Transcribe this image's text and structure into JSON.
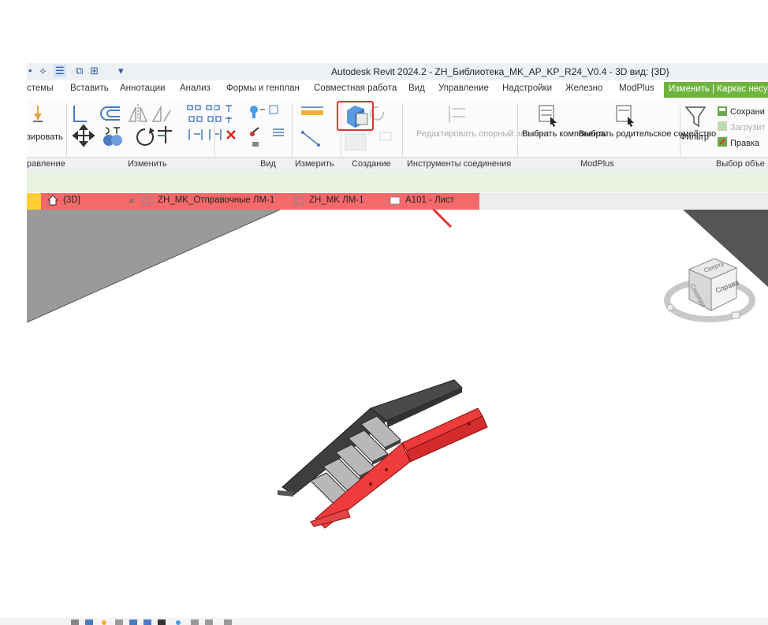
{
  "window": {
    "title": "Autodesk Revit 2024.2 - ZH_Библиотека_MK_AP_KP_R24_V0.4 - 3D вид: {3D}"
  },
  "quick_access": [
    "•",
    "⟡",
    "☰",
    "⧉",
    "⊞",
    "▾"
  ],
  "ribbon_tabs": [
    "стемы",
    "Вставить",
    "Аннотации",
    "Анализ",
    "Формы и генплан",
    "Совместная работа",
    "Вид",
    "Управление",
    "Надстройки",
    "Железно",
    "ModPlus"
  ],
  "active_tab": "Изменить | Каркас несущ",
  "ribbon": {
    "modify_button": "зировать",
    "edit_ref_button": "Редактировать опорный элемент",
    "select_components": "Выбрать компоненты",
    "select_parent_family": "Выбрать родительское семейство",
    "filter": "Фильтр",
    "save": "Сохрани",
    "load": "Загрузит",
    "edit": "Правка"
  },
  "panels": [
    "равление",
    "Изменить",
    "Вид",
    "Измерить",
    "Создание",
    "Инструменты соединения",
    "ModPlus",
    "Выбор объе"
  ],
  "view_tabs": [
    {
      "label": "{3D}",
      "icon": "home-icon"
    },
    {
      "label": "ZH_MK_Отправочные ЛМ-1",
      "icon": "sheet-icon"
    },
    {
      "label": "ZH_MK ЛМ-1",
      "icon": "sheet-icon"
    },
    {
      "label": "A101 - Лист",
      "icon": "sheet-icon"
    }
  ],
  "viewcube": {
    "front_face": "Справа",
    "top_face": "Сверху",
    "left_face": "Спереди"
  },
  "colors": {
    "accent_green": "#6fb43c",
    "highlight_red": "#e03333",
    "selection_red": "#ee3b3b",
    "view_tab_red": "#f46a6a"
  }
}
